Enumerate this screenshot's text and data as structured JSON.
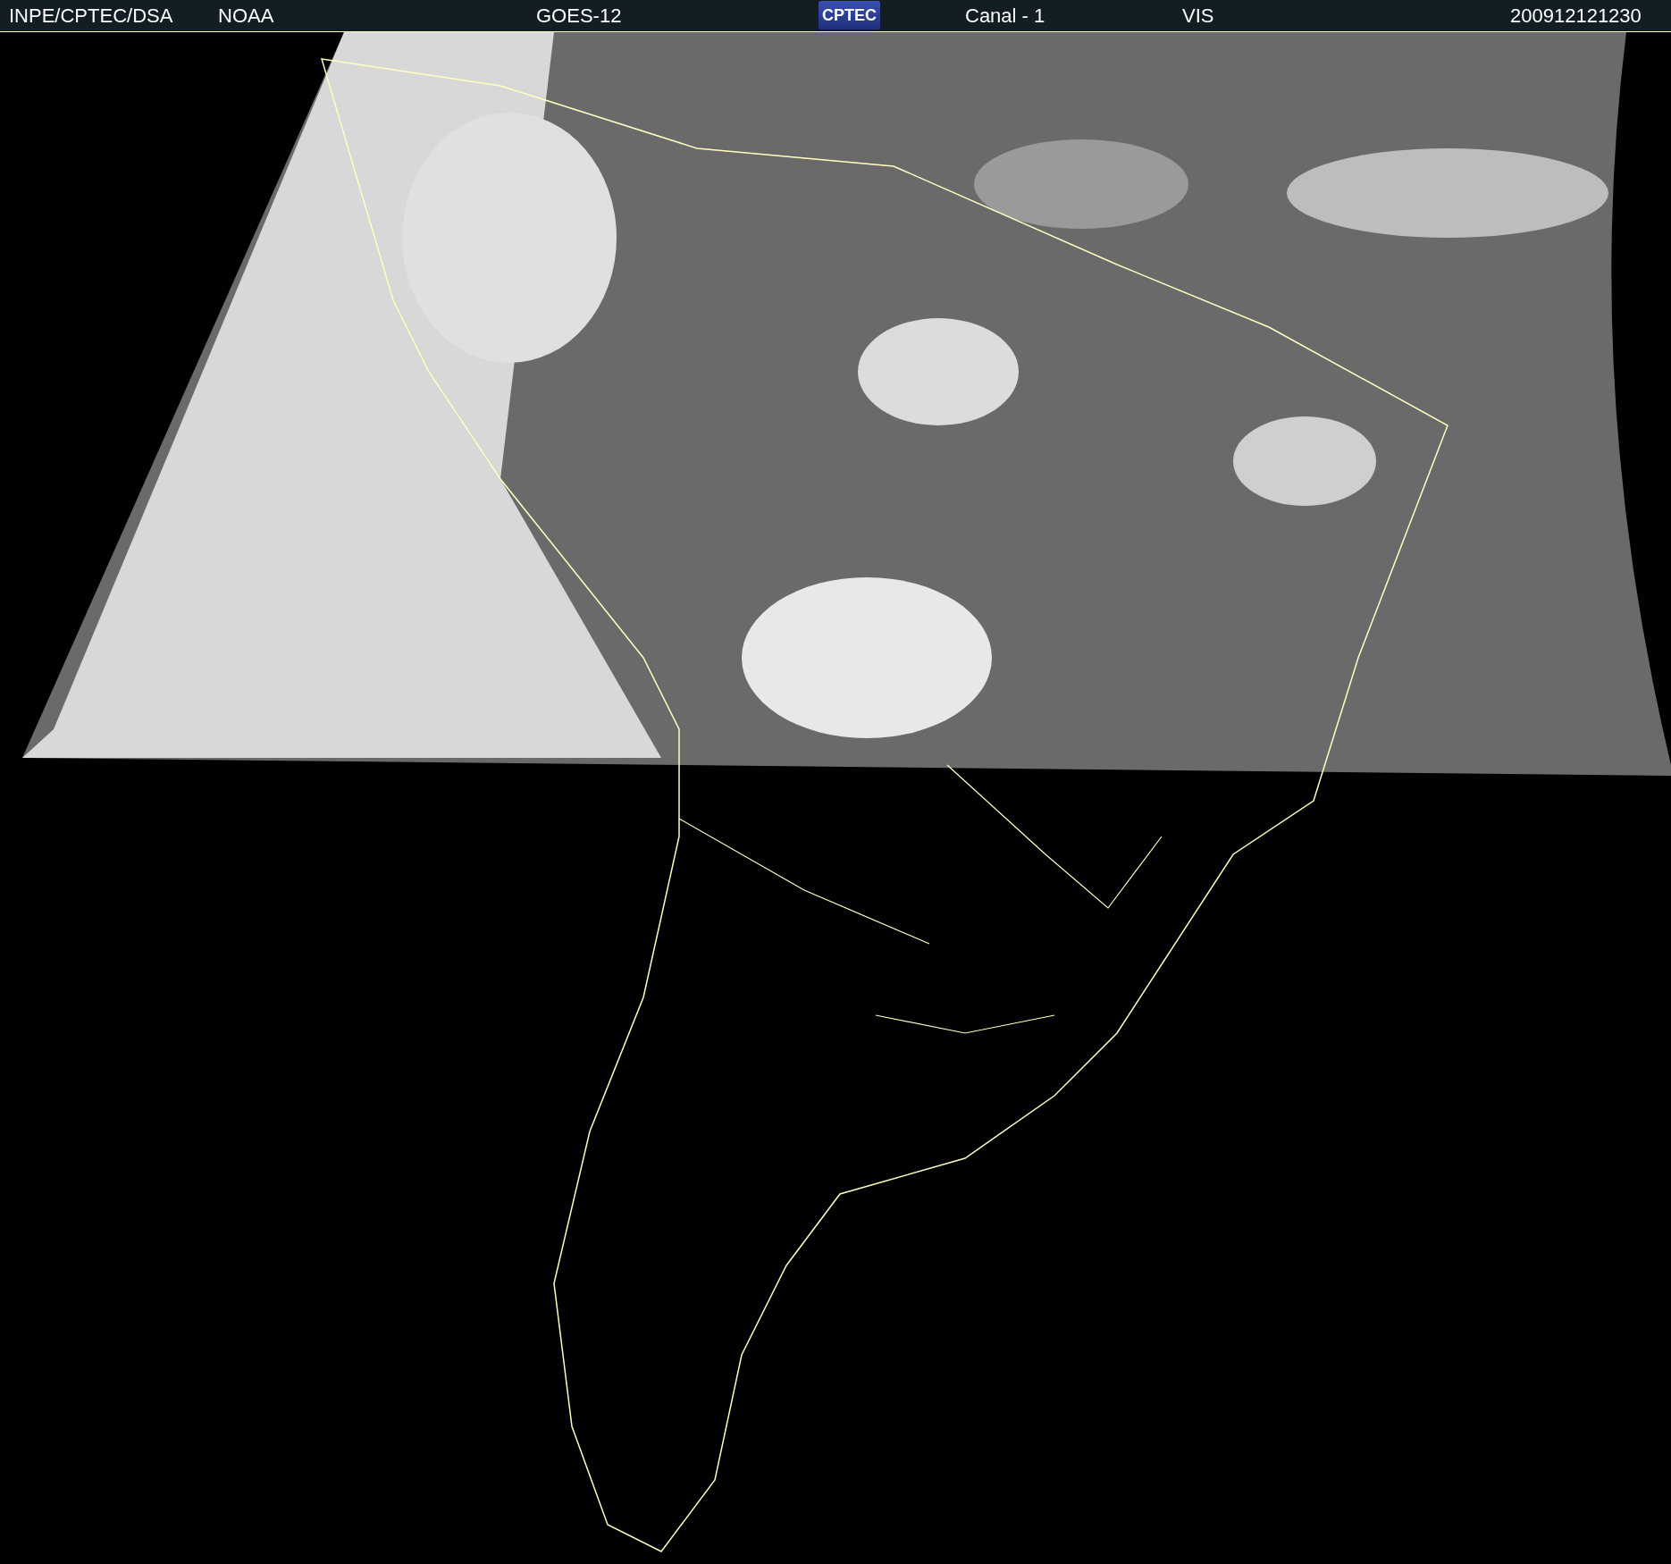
{
  "header": {
    "items": [
      {
        "kind": "text",
        "text": "INPE/CPTEC/DSA"
      },
      {
        "kind": "text",
        "text": "NOAA"
      },
      {
        "kind": "text",
        "text": "GOES-12"
      },
      {
        "kind": "logo",
        "text": "CPTEC"
      },
      {
        "kind": "text",
        "text": "Canal - 1"
      },
      {
        "kind": "text",
        "text": "VIS"
      },
      {
        "kind": "text",
        "text": "200912121230"
      }
    ]
  }
}
